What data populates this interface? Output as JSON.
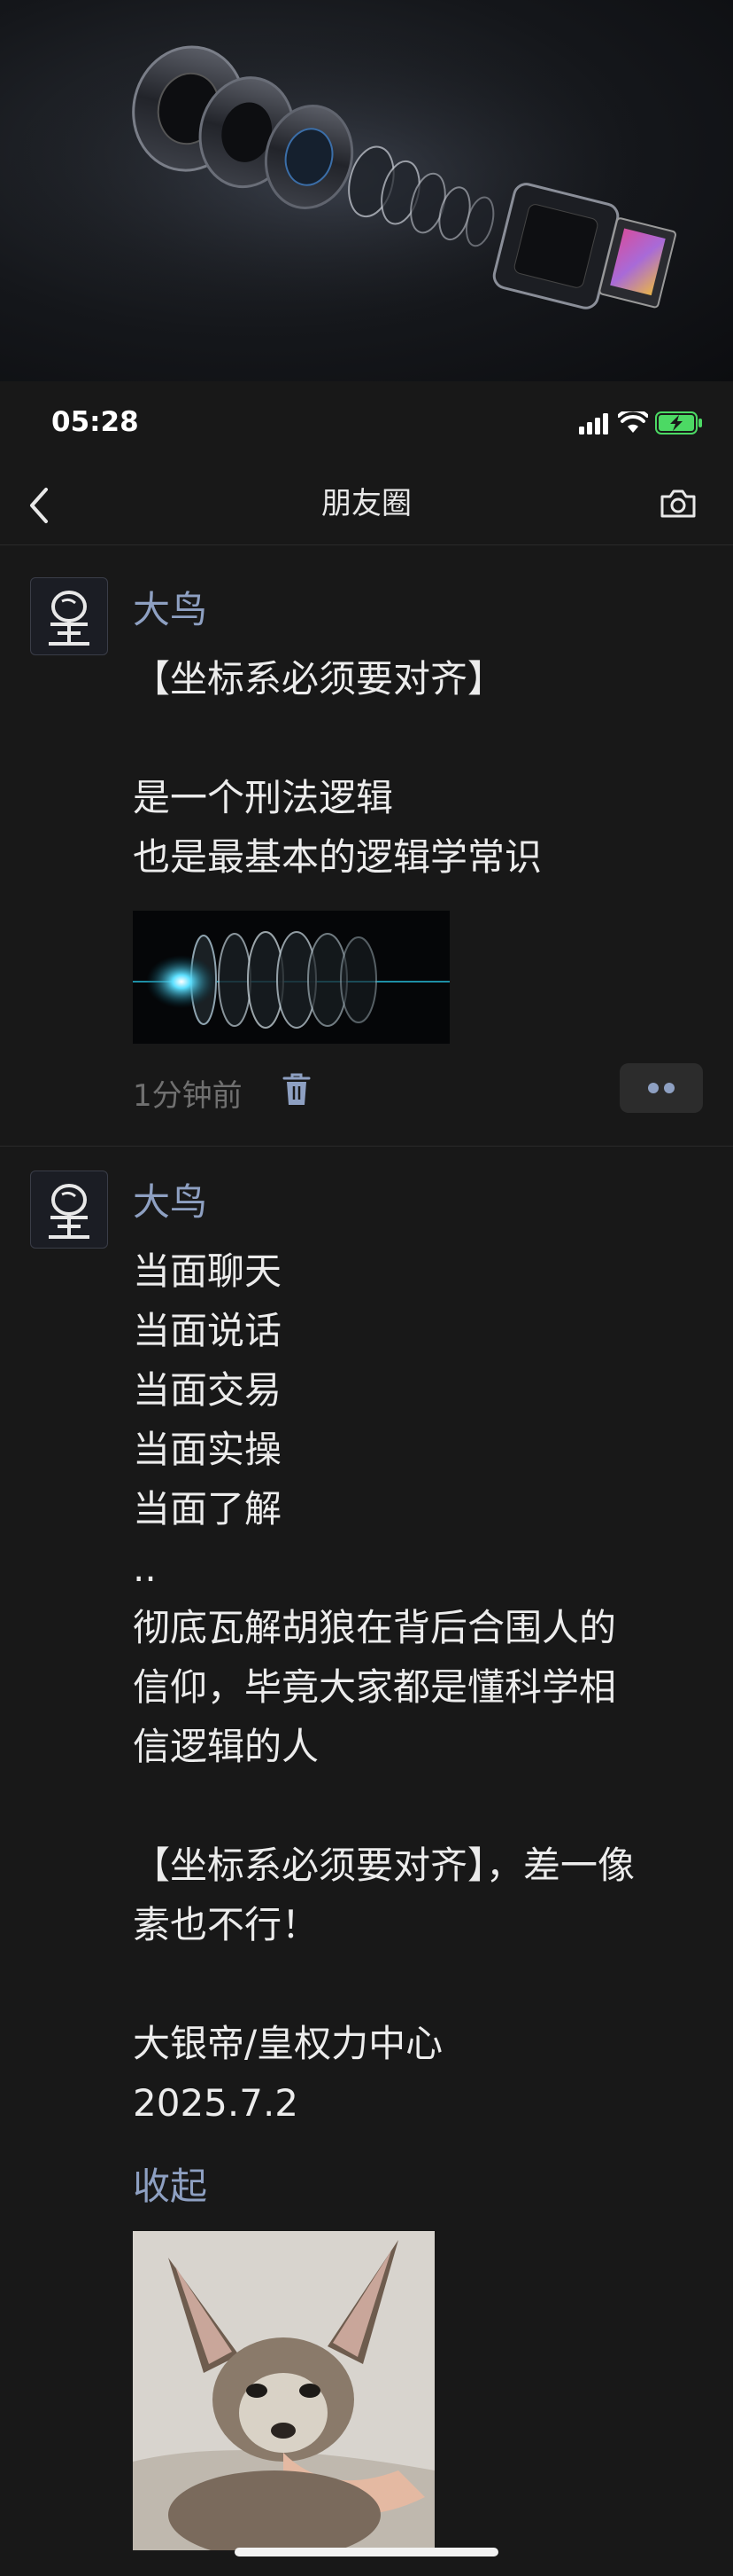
{
  "status": {
    "time": "05:28"
  },
  "nav": {
    "title": "朋友圈"
  },
  "posts": [
    {
      "author": "大鸟",
      "text": "【坐标系必须要对齐】\n\n是一个刑法逻辑\n也是最基本的逻辑学常识",
      "time": "1分钟前"
    },
    {
      "author": "大鸟",
      "text": "当面聊天\n当面说话\n当面交易\n当面实操\n当面了解\n..\n彻底瓦解胡狼在背后合围人的\n信仰，毕竟大家都是懂科学相\n信逻辑的人\n\n【坐标系必须要对齐】，差一像\n素也不行！\n\n大银帝/皇权力中心\n2025.7.2",
      "collapse": "收起"
    }
  ],
  "icons": {
    "back": "back-chevron-icon",
    "camera": "camera-icon",
    "trash": "trash-icon",
    "signal": "signal-icon",
    "wifi": "wifi-icon",
    "battery": "battery-charging-icon",
    "more": "more-dots-icon"
  },
  "colors": {
    "background": "#181818",
    "author": "#8ea0c2",
    "battery": "#4cd964"
  }
}
